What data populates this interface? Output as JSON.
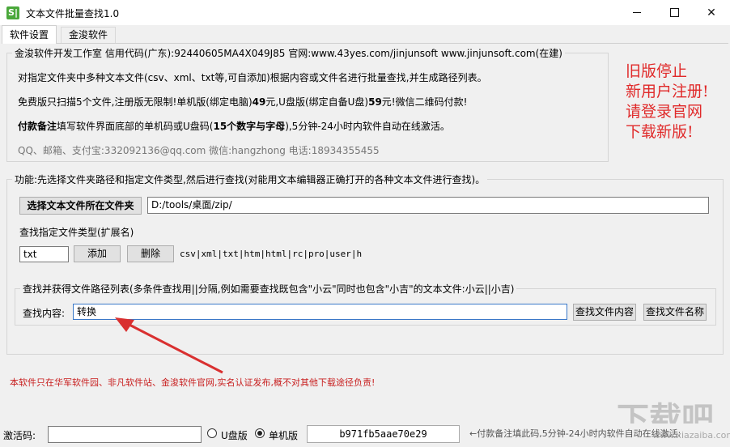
{
  "window": {
    "title": "文本文件批量查找1.0",
    "app_icon_glyph": "S|",
    "minimize_glyph": "minimize-icon",
    "maximize_glyph": "maximize-icon",
    "close_glyph": "✕"
  },
  "tabs": [
    {
      "label": "软件设置",
      "active": true
    },
    {
      "label": "金浚软件",
      "active": false
    }
  ],
  "info": {
    "legend": "金浚软件开发工作室 信用代码(广东):92440605MA4X049J85 官网:www.43yes.com/jinjunsoft  www.jinjunsoft.com(在建)",
    "line1": "对指定文件夹中多种文本文件(csv、xml、txt等,可自添加)根据内容或文件名进行批量查找,并生成路径列表。",
    "line2_pre": "免费版只扫描5个文件,注册版无限制!单机版(绑定电脑)",
    "line2_price1": "49",
    "line2_mid": "元,U盘版(绑定自备U盘)",
    "line2_price2": "59",
    "line2_post": "元!微信二维码付款!",
    "line3_bold": "付款备注",
    "line3_mid": "填写软件界面底部的单机码或U盘码(",
    "line3_bold2": "15个数字与字母",
    "line3_post": "),5分钟-24小时内软件自动在线激活。",
    "contact": "QQ、邮箱、支付宝:332092136@qq.com     微信:hangzhong     电话:18934355455"
  },
  "notice": {
    "line1": "旧版停止",
    "line2": "新用户注册!",
    "line3": "请登录官网",
    "line4": "下载新版!"
  },
  "function_group": {
    "legend": "功能:先选择文件夹路径和指定文件类型,然后进行查找(对能用文本编辑器正确打开的各种文本文件进行查找)。",
    "select_folder_label": "选择文本文件所在文件夹",
    "folder_path": "D:/tools/桌面/zip/",
    "filetype_label": "查找指定文件类型(扩展名)",
    "ext_value": "txt",
    "add_label": "添加",
    "delete_label": "删除",
    "ext_list": "csv|xml|txt|htm|html|rc|pro|user|h"
  },
  "search_group": {
    "legend": "查找并获得文件路径列表(多条件查找用||分隔,例如需要查找既包含\"小云\"同时也包含\"小吉\"的文本文件:小云||小吉)",
    "content_label": "查找内容:",
    "content_value": "转换",
    "find_content_label": "查找文件内容",
    "find_name_label": "查找文件名称"
  },
  "warning": "本软件只在华军软件园、非凡软件站、金浚软件官网,实名认证发布,概不对其他下载途径负责!",
  "status": {
    "activation_label": "激活码:",
    "activation_value": "",
    "usb_label": "U盘版",
    "standalone_label": "单机版",
    "selected": "单机版",
    "serial": "b971fb5aae70e29",
    "hint": "←付款备注填此码,5分钟-24小时内软件自动在线激活:"
  },
  "watermark": {
    "main": "下载吧",
    "sub": "www.xiazaiba.com"
  },
  "colors": {
    "notice_red": "#e02a2a",
    "warning_red": "#c81e1e",
    "arrow_red": "#d93030"
  }
}
